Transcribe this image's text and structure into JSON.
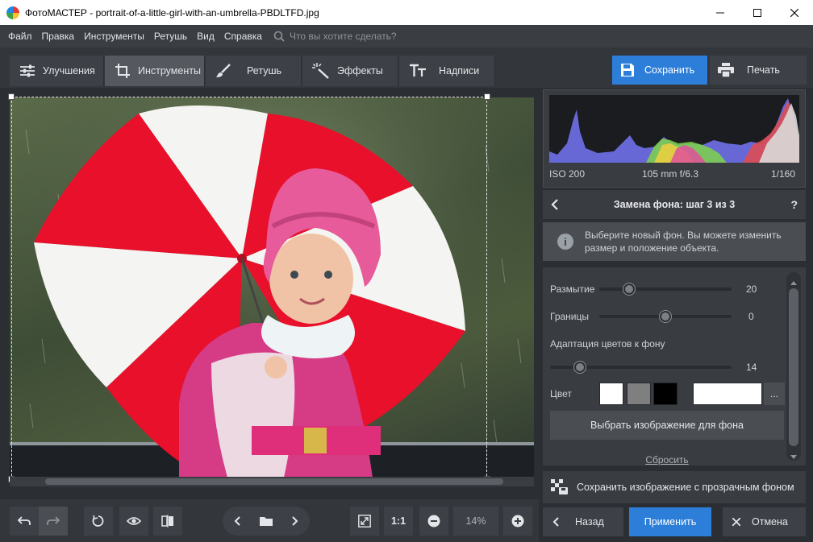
{
  "window": {
    "title": "ФотоМАСТЕР - portrait-of-a-little-girl-with-an-umbrella-PBDLTFD.jpg",
    "controls": [
      "minimize",
      "maximize",
      "close"
    ]
  },
  "menu": {
    "items": [
      "Файл",
      "Правка",
      "Инструменты",
      "Ретушь",
      "Вид",
      "Справка"
    ],
    "search_placeholder": "Что вы хотите сделать?"
  },
  "tabs": [
    {
      "label": "Улучшения",
      "icon": "sliders-icon",
      "active": false
    },
    {
      "label": "Инструменты",
      "icon": "crop-icon",
      "active": true
    },
    {
      "label": "Ретушь",
      "icon": "brush-icon",
      "active": false
    },
    {
      "label": "Эффекты",
      "icon": "magic-wand-icon",
      "active": false
    },
    {
      "label": "Надписи",
      "icon": "text-icon",
      "active": false
    }
  ],
  "actions": {
    "save_label": "Сохранить",
    "print_label": "Печать"
  },
  "histogram": {
    "iso": "ISO 200",
    "lens": "105 mm f/6.3",
    "shutter": "1/160"
  },
  "panel": {
    "step_title": "Замена фона: шаг 3 из 3",
    "help": "?",
    "info_text": "Выберите новый фон. Вы можете изменить размер и положение объекта.",
    "blur": {
      "label": "Размытие",
      "value": "20",
      "fraction": 0.2
    },
    "borders": {
      "label": "Границы",
      "value": "0",
      "fraction": 0.5
    },
    "color_adapt": {
      "label": "Адаптация цветов к фону",
      "value": "14",
      "fraction": 0.14
    },
    "color_label": "Цвет",
    "swatches": [
      "#ffffff",
      "#7f7f7f",
      "#000000"
    ],
    "selected_color": "#ffffff",
    "more": "...",
    "choose_bg": "Выбрать изображение для фона",
    "reset": "Сбросить",
    "save_transparent": "Сохранить изображение с прозрачным фоном",
    "back": "Назад",
    "apply": "Применить",
    "cancel": "Отмена"
  },
  "bottom": {
    "one_to_one": "1:1",
    "zoom": "14%"
  },
  "colors": {
    "accent": "#2d7ed9",
    "panel_bg": "#393c41",
    "app_bg": "#2b2e33"
  }
}
